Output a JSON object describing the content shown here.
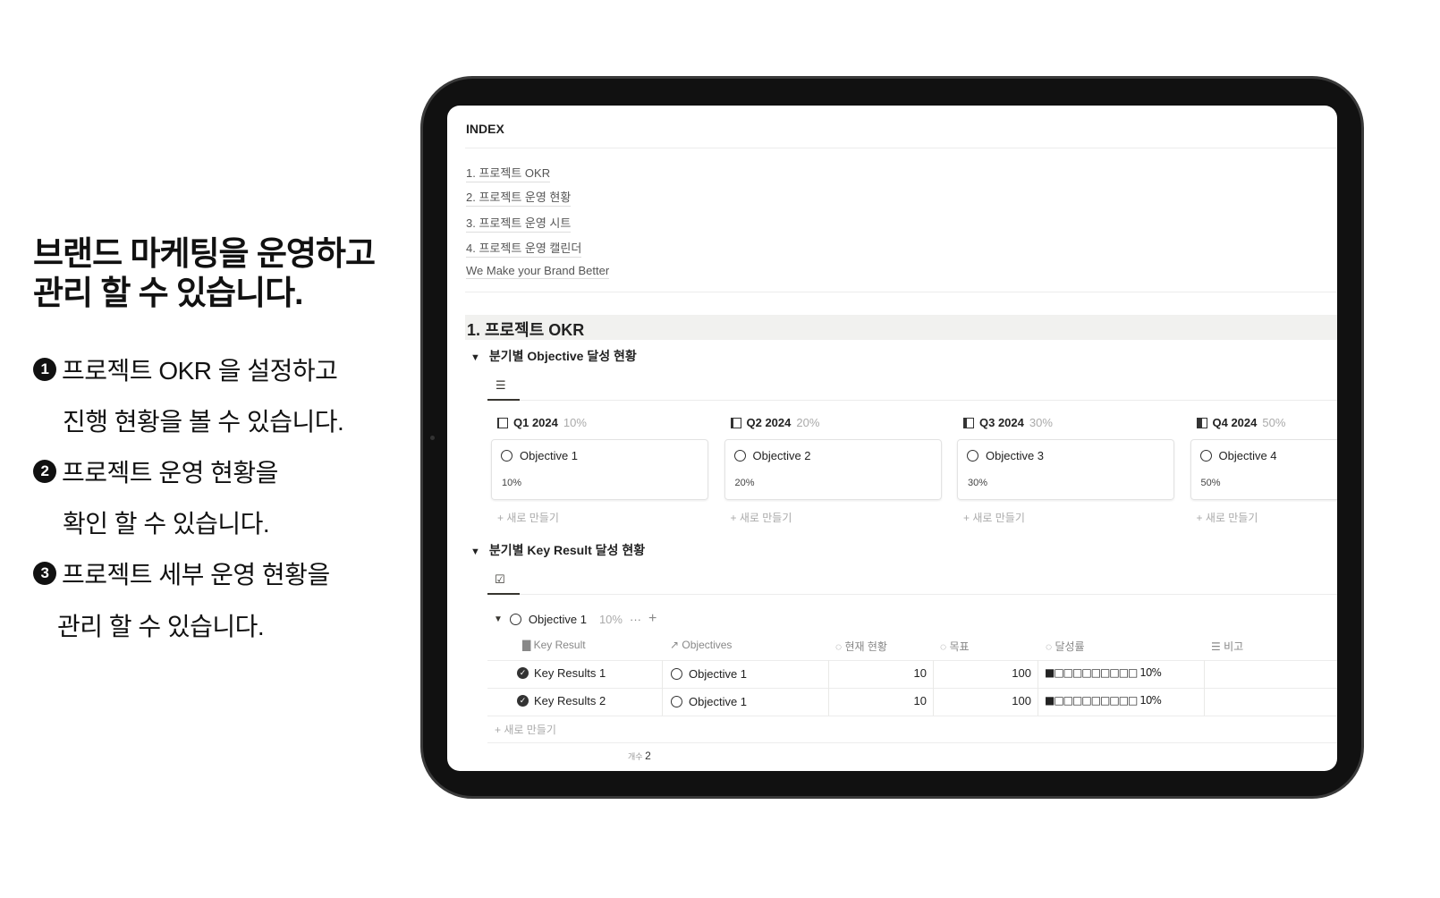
{
  "headline": [
    "브랜드 마케팅을 운영하고",
    "관리 할 수 있습니다."
  ],
  "features": [
    {
      "num": "1",
      "lines": [
        "프로젝트 OKR 을 설정하고",
        "진행 현황을 볼 수 있습니다."
      ]
    },
    {
      "num": "2",
      "lines": [
        "프로젝트 운영 현황을",
        "확인 할 수 있습니다."
      ]
    },
    {
      "num": "3",
      "lines": [
        "프로젝트 세부 운영 현황을",
        "관리 할 수 있습니다."
      ]
    }
  ],
  "page": {
    "index_title": "INDEX",
    "index_links": [
      "1. 프로젝트 OKR",
      "2. 프로젝트 운영 현황",
      "3. 프로젝트 운영 시트",
      "4. 프로젝트 운영 캘린더",
      "We Make your Brand Better"
    ],
    "section_title": "1. 프로젝트 OKR",
    "objective_toggle": "분기별 Objective 달성 현황",
    "board_columns": [
      {
        "quarter": "Q1 2024",
        "pct": "10%",
        "progress": 0.1,
        "card_title": "Objective 1",
        "card_value": "10%"
      },
      {
        "quarter": "Q2 2024",
        "pct": "20%",
        "progress": 0.2,
        "card_title": "Objective 2",
        "card_value": "20%"
      },
      {
        "quarter": "Q3 2024",
        "pct": "30%",
        "progress": 0.3,
        "card_title": "Objective 3",
        "card_value": "30%"
      },
      {
        "quarter": "Q4 2024",
        "pct": "50%",
        "progress": 0.5,
        "card_title": "Objective 4",
        "card_value": "50%"
      }
    ],
    "new_label": "+ 새로 만들기",
    "kr_toggle": "분기별 Key Result 달성 현황",
    "group": {
      "title": "Objective 1",
      "pct": "10%",
      "more": "···",
      "add": "+"
    },
    "table_headers": [
      "Key Result",
      "Objectives",
      "현재 현황",
      "목표",
      "달성률",
      "비고"
    ],
    "rows": [
      {
        "key_result": "Key Results 1",
        "objective": "Objective 1",
        "current": "10",
        "target": "100",
        "rate": "■□□□□□□□□□ 10%",
        "note": ""
      },
      {
        "key_result": "Key Results 2",
        "objective": "Objective 1",
        "current": "10",
        "target": "100",
        "rate": "■□□□□□□□□□ 10%",
        "note": ""
      }
    ],
    "count_label": "개수",
    "count_value": "2"
  }
}
